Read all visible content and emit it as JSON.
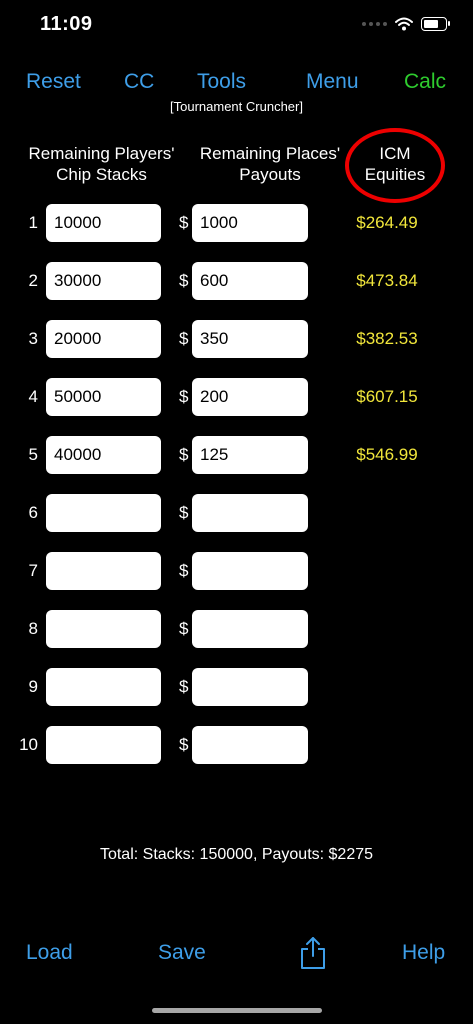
{
  "status": {
    "time": "11:09"
  },
  "nav": {
    "reset": "Reset",
    "cc": "CC",
    "tools": "Tools",
    "menu": "Menu",
    "calc": "Calc"
  },
  "subtitle": "[Tournament Cruncher]",
  "headers": {
    "chip_line1": "Remaining Players'",
    "chip_line2": "Chip Stacks",
    "payout_line1": "Remaining Places'",
    "payout_line2": "Payouts",
    "icm_line1": "ICM",
    "icm_line2": "Equities"
  },
  "currency": "$",
  "rows": [
    {
      "num": "1",
      "chips": "10000",
      "payout": "1000",
      "equity": "$264.49"
    },
    {
      "num": "2",
      "chips": "30000",
      "payout": "600",
      "equity": "$473.84"
    },
    {
      "num": "3",
      "chips": "20000",
      "payout": "350",
      "equity": "$382.53"
    },
    {
      "num": "4",
      "chips": "50000",
      "payout": "200",
      "equity": "$607.15"
    },
    {
      "num": "5",
      "chips": "40000",
      "payout": "125",
      "equity": "$546.99"
    },
    {
      "num": "6",
      "chips": "",
      "payout": "",
      "equity": ""
    },
    {
      "num": "7",
      "chips": "",
      "payout": "",
      "equity": ""
    },
    {
      "num": "8",
      "chips": "",
      "payout": "",
      "equity": ""
    },
    {
      "num": "9",
      "chips": "",
      "payout": "",
      "equity": ""
    },
    {
      "num": "10",
      "chips": "",
      "payout": "",
      "equity": ""
    }
  ],
  "total": "Total: Stacks: 150000, Payouts: $2275",
  "bottom": {
    "load": "Load",
    "save": "Save",
    "help": "Help",
    "share_icon": "share-icon"
  },
  "colors": {
    "accent": "#3e9ee8",
    "calc": "#2ecc2e",
    "equity": "#f2e73b",
    "highlight_circle": "#e00000"
  }
}
